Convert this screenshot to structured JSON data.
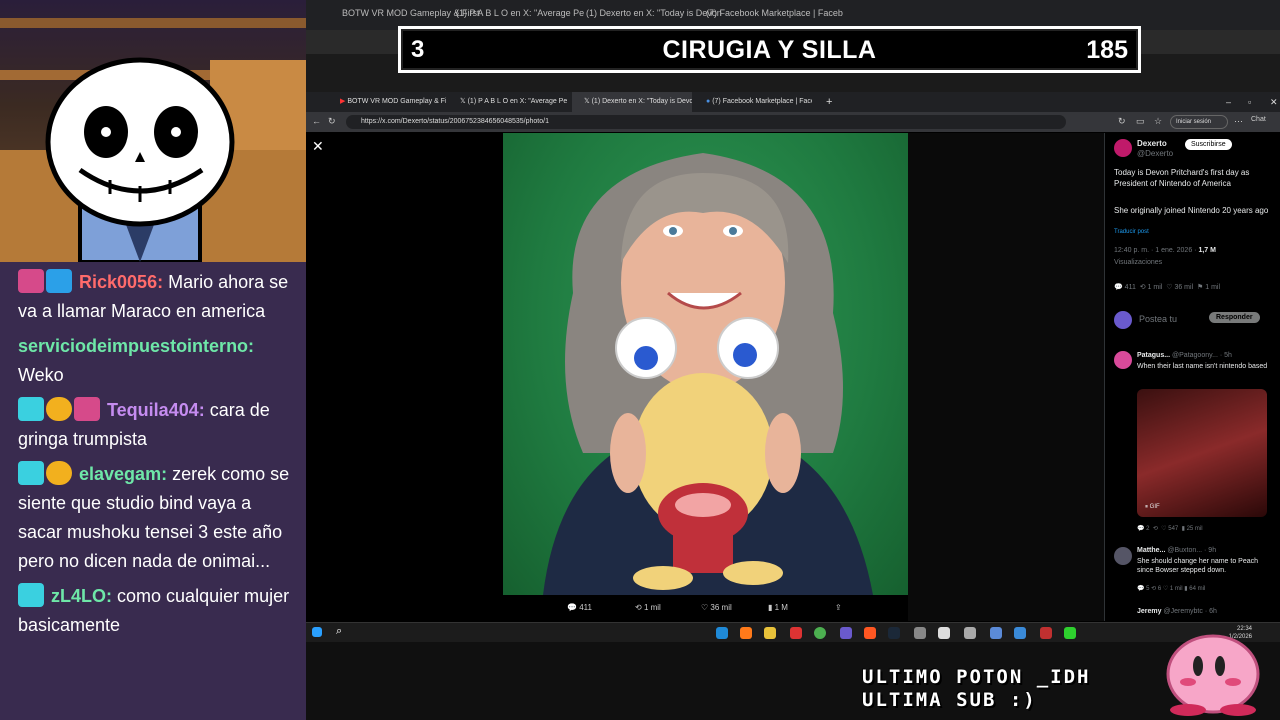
{
  "banner": {
    "number": "3",
    "title": "CIRUGIA Y SILLA",
    "score": "185"
  },
  "chat": [
    {
      "user": "Rick0056:",
      "color": "#ff6b6b",
      "text": "Mario ahora se va a llamar Maraco en america"
    },
    {
      "user": "serviciodeimpuestointerno:",
      "color": "#6ee7a8",
      "text": "Weko"
    },
    {
      "user": "Tequila404:",
      "color": "#c58cf0",
      "text": "cara de gringa trumpista"
    },
    {
      "user": "elavegam:",
      "color": "#6ee7a8",
      "text": "zerek como se siente que studio bind vaya a sacar mushoku tensei 3 este año pero no dicen nada de onimai..."
    },
    {
      "user": "zL4LO:",
      "color": "#6ee7a8",
      "text": "como cualquier mujer basicamente"
    }
  ],
  "browser": {
    "tabs": [
      {
        "label": "BOTW VR MOD Gameplay & First"
      },
      {
        "label": "(1) P A B L O en X: \"Average Pe"
      },
      {
        "label": "(1) Dexerto en X: \"Today is Devon"
      },
      {
        "label": "(7) Facebook Marketplace | Faceb"
      }
    ],
    "new_tab": "+",
    "url": "https://x.com/Dexerto/status/2006752384656048535/photo/1",
    "signin": "Iniciar sesión",
    "chat_label": "Chat"
  },
  "post_actions": {
    "replies": "411",
    "reposts": "1 mil",
    "likes": "36 mil",
    "views": "1 M"
  },
  "tweet": {
    "author": "Dexerto",
    "handle": "@Dexerto",
    "subscribe": "Suscribirse",
    "text1": "Today is Devon Pritchard's first day as President of Nintendo of America",
    "text2": "She originally joined Nintendo 20 years ago",
    "translate": "Traducir post",
    "time": "12:40 p. m. · 1 ene. 2026 ·",
    "views_count": "1,7 M",
    "views_label": "Visualizaciones",
    "stats": {
      "replies": "411",
      "reposts": "1 mil",
      "likes": "36 mil",
      "bookmarks": "1 mil"
    },
    "post_placeholder": "Postea tu",
    "reply_button": "Responder"
  },
  "replies": [
    {
      "name": "Patagus...",
      "handle": "@Patagoony...",
      "time": "· 5h",
      "text": "When their last name isn't nintendo based",
      "media_label": "GIF",
      "stats": {
        "replies": "2",
        "likes": "547",
        "views": "25 mil"
      }
    },
    {
      "name": "Matthe...",
      "handle": "@Buxton...",
      "time": "· 9h",
      "text": "She should change her name to Peach since Bowser stepped down.",
      "stats": {
        "replies": "5",
        "reposts": "6",
        "likes": "1 mil",
        "views": "64 mil"
      }
    },
    {
      "name": "Jeremy",
      "handle": "@Jeremybtc",
      "time": "· 6h"
    }
  ],
  "taskbar": {
    "time": "22:34",
    "date": "1/2/2026"
  },
  "overlay": {
    "line1": "ULTIMO POTON _IDH",
    "line2": "ULTIMA SUB :)"
  },
  "colors": {
    "twitter_blue": "#1d9bf0",
    "green_screen": "#2f9a55",
    "chat_bg": "#392b4f"
  }
}
